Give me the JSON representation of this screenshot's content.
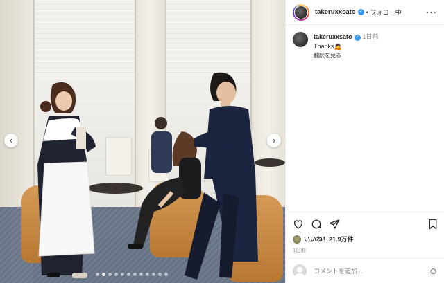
{
  "post": {
    "username": "takeruxxsato",
    "separator": "•",
    "follow_status": "フォロー中",
    "caption_username": "takeruxxsato",
    "caption_time": "1日前",
    "caption_text": "Thanks🙇",
    "translate_link": "翻訳を見る",
    "likes": "いいね！21.9万件",
    "post_time": "1日前",
    "comment_placeholder": "コメントを追加...",
    "carousel_slides": 12,
    "carousel_active_index": 1
  },
  "icons": {
    "prev": "chevron-left-icon",
    "next": "chevron-right-icon",
    "more": "more-options-icon",
    "like": "heart-icon",
    "comment": "comment-icon",
    "share": "share-icon",
    "save": "bookmark-icon",
    "emoji": "emoji-icon"
  },
  "colors": {
    "verified": "#3897f0",
    "text": "#262626",
    "muted": "#8e8e8e"
  }
}
